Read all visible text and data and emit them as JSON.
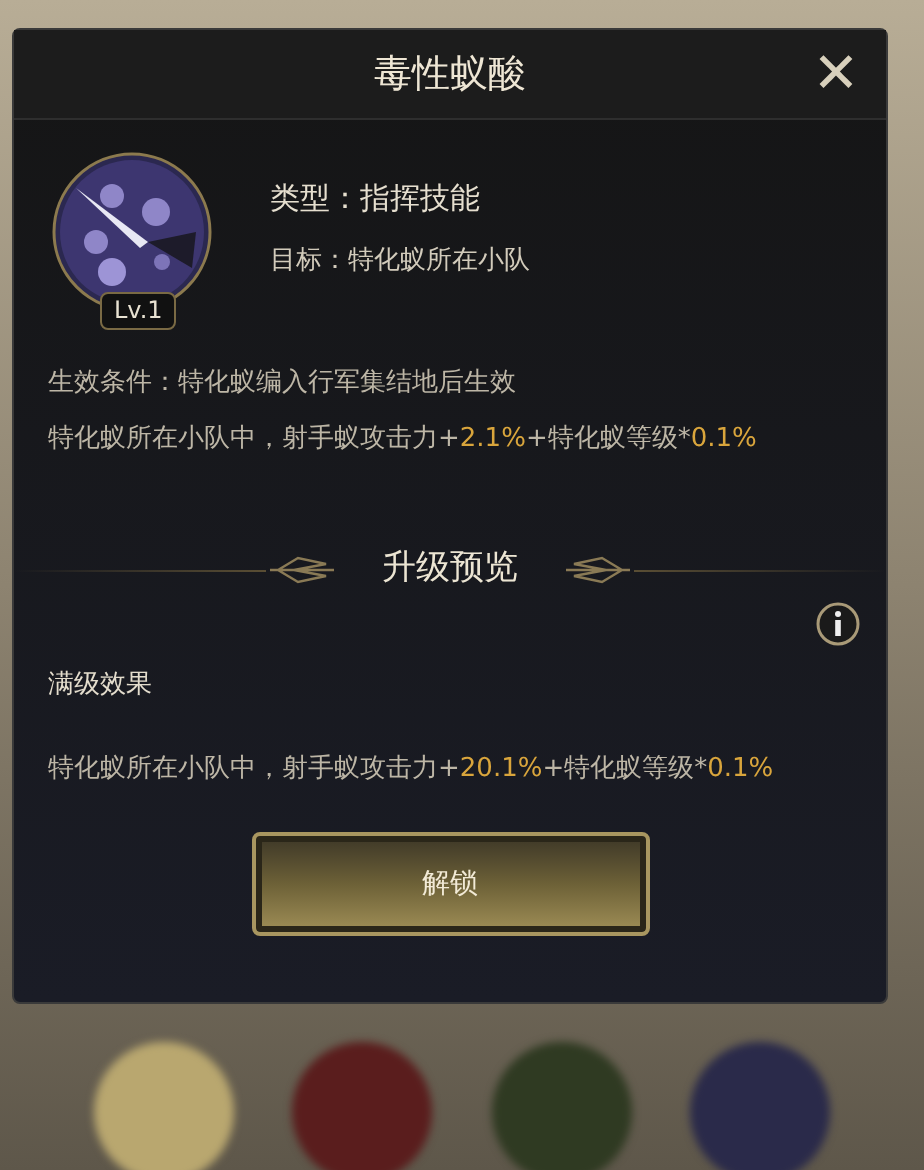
{
  "dialog": {
    "title": "毒性蚁酸",
    "close": "✕"
  },
  "skill": {
    "level": "Lv.1",
    "type": "类型：指挥技能",
    "target": "目标：特化蚁所在小队"
  },
  "condition": "生效条件：特化蚁编入行军集结地后生效",
  "effect": [
    {
      "text": "特化蚁所在小队中，射手蚁攻击力+",
      "highlight": false
    },
    {
      "text": "2.1%",
      "highlight": true
    },
    {
      "text": "+特化蚁等级*",
      "highlight": false
    },
    {
      "text": "0.1%",
      "highlight": true
    }
  ],
  "preview": {
    "heading": "升级预览",
    "max_label": "满级效果",
    "max_effect": [
      {
        "text": "特化蚁所在小队中，射手蚁攻击力+",
        "highlight": false
      },
      {
        "text": "20.1%",
        "highlight": true
      },
      {
        "text": "+特化蚁等级*",
        "highlight": false
      },
      {
        "text": "0.1%",
        "highlight": true
      }
    ]
  },
  "unlock_button": "解锁"
}
